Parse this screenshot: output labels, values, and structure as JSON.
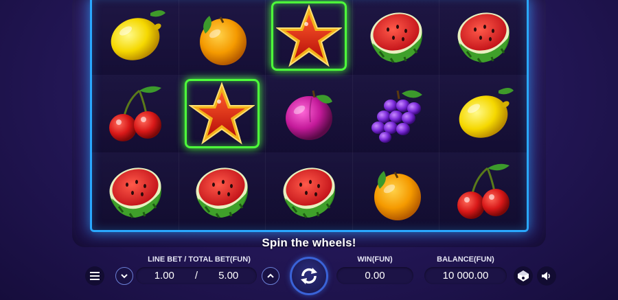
{
  "grid": [
    [
      "lemon",
      "orange",
      "star",
      "watermelon",
      "watermelon"
    ],
    [
      "cherries",
      "star",
      "plum",
      "grapes",
      "lemon"
    ],
    [
      "watermelon",
      "watermelon",
      "watermelon",
      "orange",
      "cherries"
    ]
  ],
  "highlighted_cells": [
    [
      0,
      2
    ],
    [
      1,
      1
    ]
  ],
  "status_message": "Spin the wheels!",
  "controls": {
    "bet_label": "LINE BET / TOTAL BET(FUN)",
    "line_bet": "1.00",
    "separator": "/",
    "total_bet": "5.00",
    "win_label": "WIN(FUN)",
    "win_value": "0.00",
    "balance_label": "BALANCE(FUN)",
    "balance_value": "10 000.00"
  },
  "icons": {
    "menu": "menu-icon",
    "bet_down": "chevron-down-icon",
    "bet_up": "chevron-up-icon",
    "spin": "spin-refresh-icon",
    "autoplay": "autoplay-icon",
    "sound": "speaker-icon"
  },
  "colors": {
    "reel_border": "#2aa8ff",
    "highlight": "#4dff3a",
    "background": "#25185a"
  }
}
